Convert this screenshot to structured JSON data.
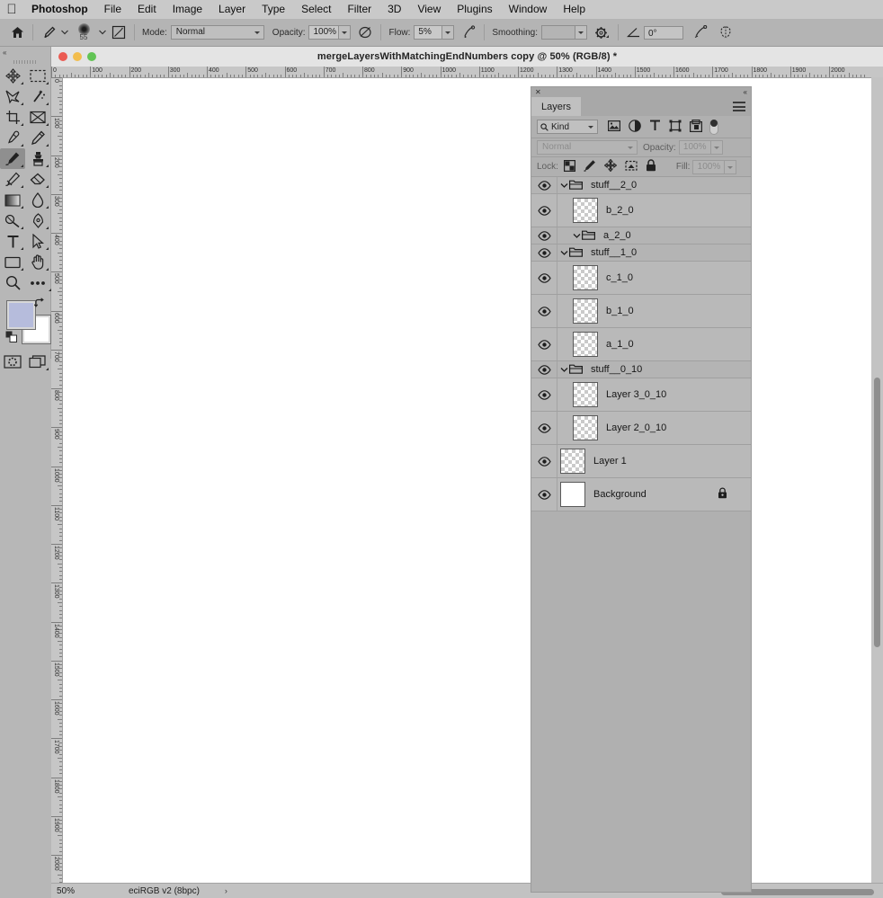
{
  "menubar": {
    "apple": "apple-logo",
    "items": [
      {
        "label": "Photoshop",
        "bold": true
      },
      {
        "label": "File"
      },
      {
        "label": "Edit"
      },
      {
        "label": "Image"
      },
      {
        "label": "Layer"
      },
      {
        "label": "Type"
      },
      {
        "label": "Select"
      },
      {
        "label": "Filter"
      },
      {
        "label": "3D"
      },
      {
        "label": "View"
      },
      {
        "label": "Plugins"
      },
      {
        "label": "Window"
      },
      {
        "label": "Help"
      }
    ]
  },
  "optionsbar": {
    "home_icon": "home-icon",
    "tool_icon": "brush-tool-icon",
    "brush_size": "55",
    "toggle_panel_icon": "brush-panel-icon",
    "mode_label": "Mode:",
    "mode_value": "Normal",
    "opacity_label": "Opacity:",
    "opacity_value": "100%",
    "pressure_opacity_icon": "pressure-opacity-icon",
    "flow_label": "Flow:",
    "flow_value": "5%",
    "airbrush_icon": "airbrush-icon",
    "smoothing_label": "Smoothing:",
    "smoothing_value": "",
    "smoothing_options_icon": "gear-icon",
    "angle_icon": "angle-icon",
    "angle_value": "0°",
    "pressure_size_icon": "pressure-size-icon",
    "symmetry_icon": "symmetry-butterfly-icon"
  },
  "document": {
    "title": "mergeLayersWithMatchingEndNumbers copy @ 50% (RGB/8) *",
    "traffic_lights": [
      "close",
      "minimize",
      "zoom"
    ],
    "ruler_h_ticks": [
      "0",
      "100",
      "200",
      "300",
      "400",
      "500",
      "600",
      "700",
      "800",
      "900",
      "1000",
      "1100",
      "1200",
      "1300",
      "1400",
      "1500",
      "1600",
      "1700",
      "1800",
      "1900",
      "2000"
    ],
    "ruler_v_ticks": [
      "0",
      "100",
      "200",
      "300",
      "400",
      "500",
      "600",
      "700",
      "800",
      "900",
      "1000",
      "1100",
      "1200",
      "1300",
      "1400",
      "1500",
      "1600",
      "1700",
      "1800",
      "1900",
      "2000"
    ]
  },
  "statusbar": {
    "zoom": "50%",
    "info": "eciRGB v2 (8bpc)",
    "arrow": "›"
  },
  "tools": {
    "collapse_icon": "collapse-panel-icon",
    "items": [
      {
        "name": "move-tool",
        "icon": "move-icon",
        "active": false
      },
      {
        "name": "rectangular-marquee-tool",
        "icon": "marquee-icon",
        "active": false
      },
      {
        "name": "lasso-tool",
        "icon": "lasso-icon",
        "active": false
      },
      {
        "name": "magic-wand-tool",
        "icon": "magic-wand-icon",
        "active": false
      },
      {
        "name": "crop-tool",
        "icon": "crop-icon",
        "active": false
      },
      {
        "name": "frame-tool",
        "icon": "frame-icon",
        "active": false
      },
      {
        "name": "eyedropper-tool",
        "icon": "eyedropper-icon",
        "active": false
      },
      {
        "name": "spot-healing-brush-tool",
        "icon": "healing-brush-icon",
        "active": false
      },
      {
        "name": "brush-tool",
        "icon": "brush-icon",
        "active": true
      },
      {
        "name": "clone-stamp-tool",
        "icon": "stamp-icon",
        "active": false
      },
      {
        "name": "history-brush-tool",
        "icon": "history-brush-icon",
        "active": false
      },
      {
        "name": "eraser-tool",
        "icon": "eraser-icon",
        "active": false
      },
      {
        "name": "gradient-tool",
        "icon": "gradient-icon",
        "active": false
      },
      {
        "name": "blur-tool",
        "icon": "blur-droplet-icon",
        "active": false
      },
      {
        "name": "dodge-tool",
        "icon": "dodge-icon",
        "active": false
      },
      {
        "name": "pen-tool",
        "icon": "pen-icon",
        "active": false
      },
      {
        "name": "type-tool",
        "icon": "type-icon",
        "active": false
      },
      {
        "name": "path-selection-tool",
        "icon": "path-arrow-icon",
        "active": false
      },
      {
        "name": "rectangle-tool",
        "icon": "rectangle-icon",
        "active": false
      },
      {
        "name": "hand-tool",
        "icon": "hand-icon",
        "active": false
      },
      {
        "name": "zoom-tool",
        "icon": "magnifier-icon",
        "active": false
      },
      {
        "name": "edit-toolbar",
        "icon": "ellipsis-icon",
        "active": false
      }
    ],
    "foreground_color": "#b6bcdc",
    "background_color": "#ffffff",
    "swap_icon": "swap-colors-icon",
    "default_icon": "default-colors-icon",
    "quickmask_icon": "quick-mask-icon",
    "screenmode_icon": "screen-mode-icon"
  },
  "layers_panel": {
    "close_icon": "close-icon",
    "collapse_icon": "collapse-double-arrow-icon",
    "tab_label": "Layers",
    "menu_icon": "panel-menu-icon",
    "filter": {
      "search_icon": "search-icon",
      "kind_label": "Kind",
      "icons": [
        {
          "name": "filter-pixel-icon"
        },
        {
          "name": "filter-adjustment-icon"
        },
        {
          "name": "filter-type-icon"
        },
        {
          "name": "filter-shape-icon"
        },
        {
          "name": "filter-smartobject-icon"
        }
      ],
      "toggle_name": "filter-enable-toggle"
    },
    "blend_mode": "Normal",
    "opacity_label": "Opacity:",
    "opacity_value": "100%",
    "lock_label": "Lock:",
    "lock_icons": [
      {
        "name": "lock-transparent-pixels-icon"
      },
      {
        "name": "lock-image-pixels-icon"
      },
      {
        "name": "lock-position-icon"
      },
      {
        "name": "lock-artboard-nesting-icon"
      },
      {
        "name": "lock-all-icon"
      }
    ],
    "fill_label": "Fill:",
    "fill_value": "100%",
    "rows": [
      {
        "name": "stuff__2_0",
        "type": "group",
        "indent": 0,
        "visible": true,
        "expanded": true,
        "locked": false
      },
      {
        "name": "b_2_0",
        "type": "layer",
        "indent": 1,
        "visible": true,
        "locked": false
      },
      {
        "name": "a_2_0",
        "type": "group",
        "indent": 1,
        "visible": true,
        "expanded": true,
        "locked": false
      },
      {
        "name": "stuff__1_0",
        "type": "group",
        "indent": 0,
        "visible": true,
        "expanded": true,
        "locked": false
      },
      {
        "name": "c_1_0",
        "type": "layer",
        "indent": 1,
        "visible": true,
        "locked": false
      },
      {
        "name": "b_1_0",
        "type": "layer",
        "indent": 1,
        "visible": true,
        "locked": false
      },
      {
        "name": "a_1_0",
        "type": "layer",
        "indent": 1,
        "visible": true,
        "locked": false
      },
      {
        "name": "stuff__0_10",
        "type": "group",
        "indent": 0,
        "visible": true,
        "expanded": true,
        "locked": false
      },
      {
        "name": "Layer 3_0_10",
        "type": "layer",
        "indent": 1,
        "visible": true,
        "locked": false
      },
      {
        "name": "Layer 2_0_10",
        "type": "layer",
        "indent": 1,
        "visible": true,
        "locked": false
      },
      {
        "name": "Layer 1",
        "type": "layer",
        "indent": 0,
        "visible": true,
        "locked": false
      },
      {
        "name": "Background",
        "type": "background",
        "indent": 0,
        "visible": true,
        "locked": true
      }
    ]
  },
  "colors": {
    "panel_bg": "#b0b0b0",
    "chrome_bg": "#b7b7b7",
    "menubar_bg": "#c9c9c9",
    "row_bg": "#b9b9b9",
    "group_row_bg": "#b4b4b4",
    "canvas": "#ffffff"
  }
}
